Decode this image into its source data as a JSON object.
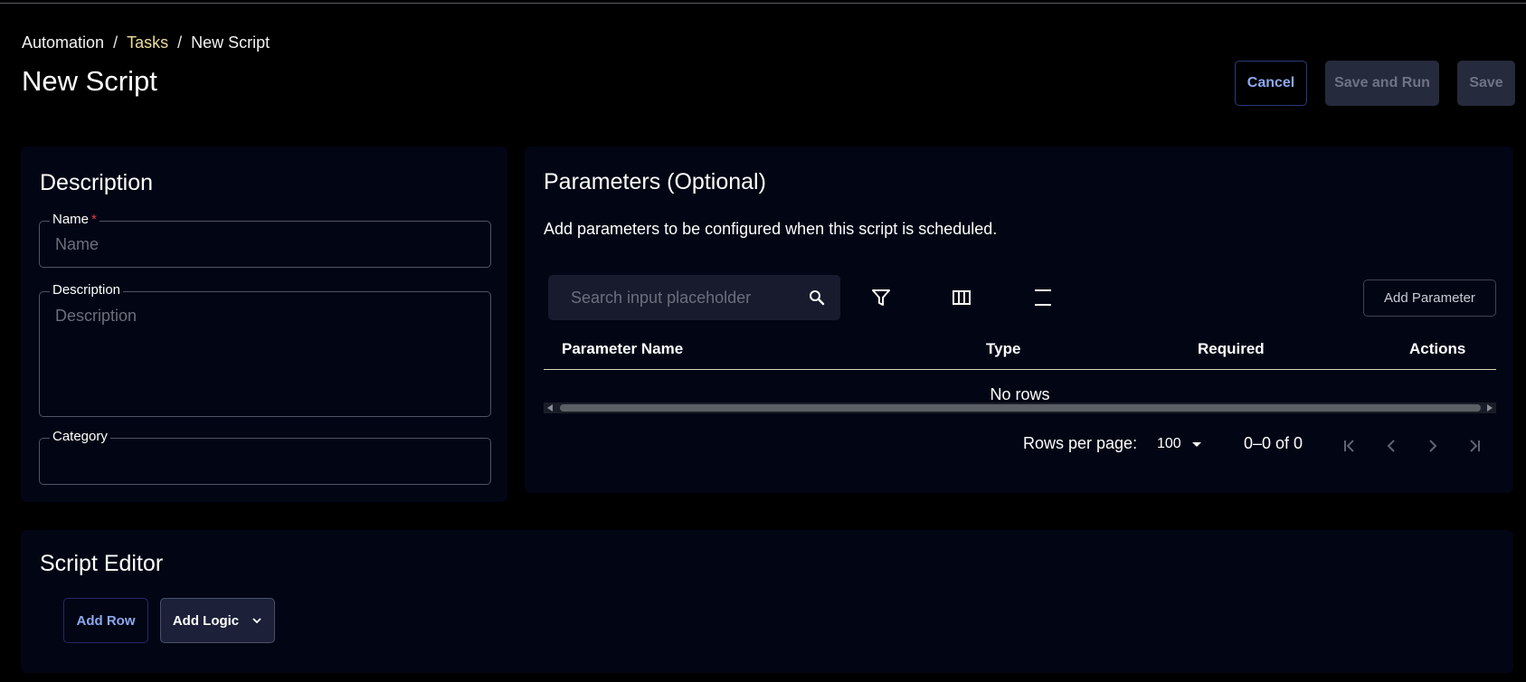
{
  "breadcrumb": {
    "root": "Automation",
    "sep1": "/",
    "parent": "Tasks",
    "sep2": "/",
    "current": "New Script"
  },
  "page_title": "New Script",
  "actions": {
    "cancel": "Cancel",
    "save_and_run": "Save and Run",
    "save": "Save"
  },
  "description_panel": {
    "title": "Description",
    "name_label": "Name",
    "name_required": "*",
    "name_placeholder": "Name",
    "description_label": "Description",
    "description_placeholder": "Description",
    "category_label": "Category"
  },
  "parameters_panel": {
    "title": "Parameters (Optional)",
    "subtitle": "Add parameters to be configured when this script is scheduled.",
    "search_placeholder": "Search input placeholder",
    "add_button": "Add Parameter",
    "columns": [
      "Parameter Name",
      "Type",
      "Required",
      "Actions"
    ],
    "empty_text": "No rows",
    "rows_per_page_label": "Rows per page:",
    "rows_per_page_value": "100",
    "range_text": "0–0 of 0"
  },
  "editor_panel": {
    "title": "Script Editor",
    "add_row": "Add Row",
    "add_logic": "Add Logic"
  },
  "colors": {
    "background": "#000000",
    "panel": "#020514",
    "accent_link": "#8ca9ee",
    "breadcrumb_link": "#eddc9a",
    "required": "#e23b3b"
  }
}
